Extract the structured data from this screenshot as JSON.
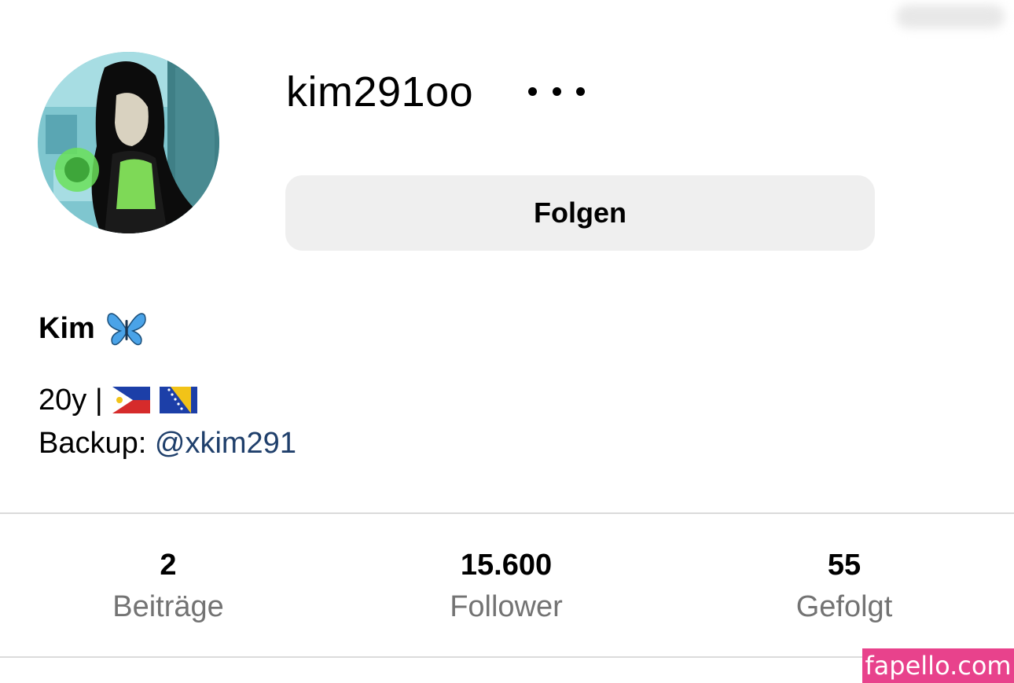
{
  "profile": {
    "username": "kim291oo",
    "more_icon": "more-horizontal-icon",
    "follow_label": "Folgen",
    "display_name": "Kim",
    "display_name_emoji": "butterfly-icon",
    "bio": {
      "age_text": "20y |",
      "flags": [
        "philippines-flag-icon",
        "bosnia-flag-icon"
      ],
      "backup_label": "Backup:",
      "backup_handle": "@xkim291"
    }
  },
  "stats": [
    {
      "value": "2",
      "label": "Beiträge"
    },
    {
      "value": "15.600",
      "label": "Follower"
    },
    {
      "value": "55",
      "label": "Gefolgt"
    }
  ],
  "watermark": "fapello.com",
  "colors": {
    "link": "#1f3f6b",
    "button_bg": "#efefef",
    "secondary_text": "#737373",
    "watermark_bg": "#e8428c"
  }
}
